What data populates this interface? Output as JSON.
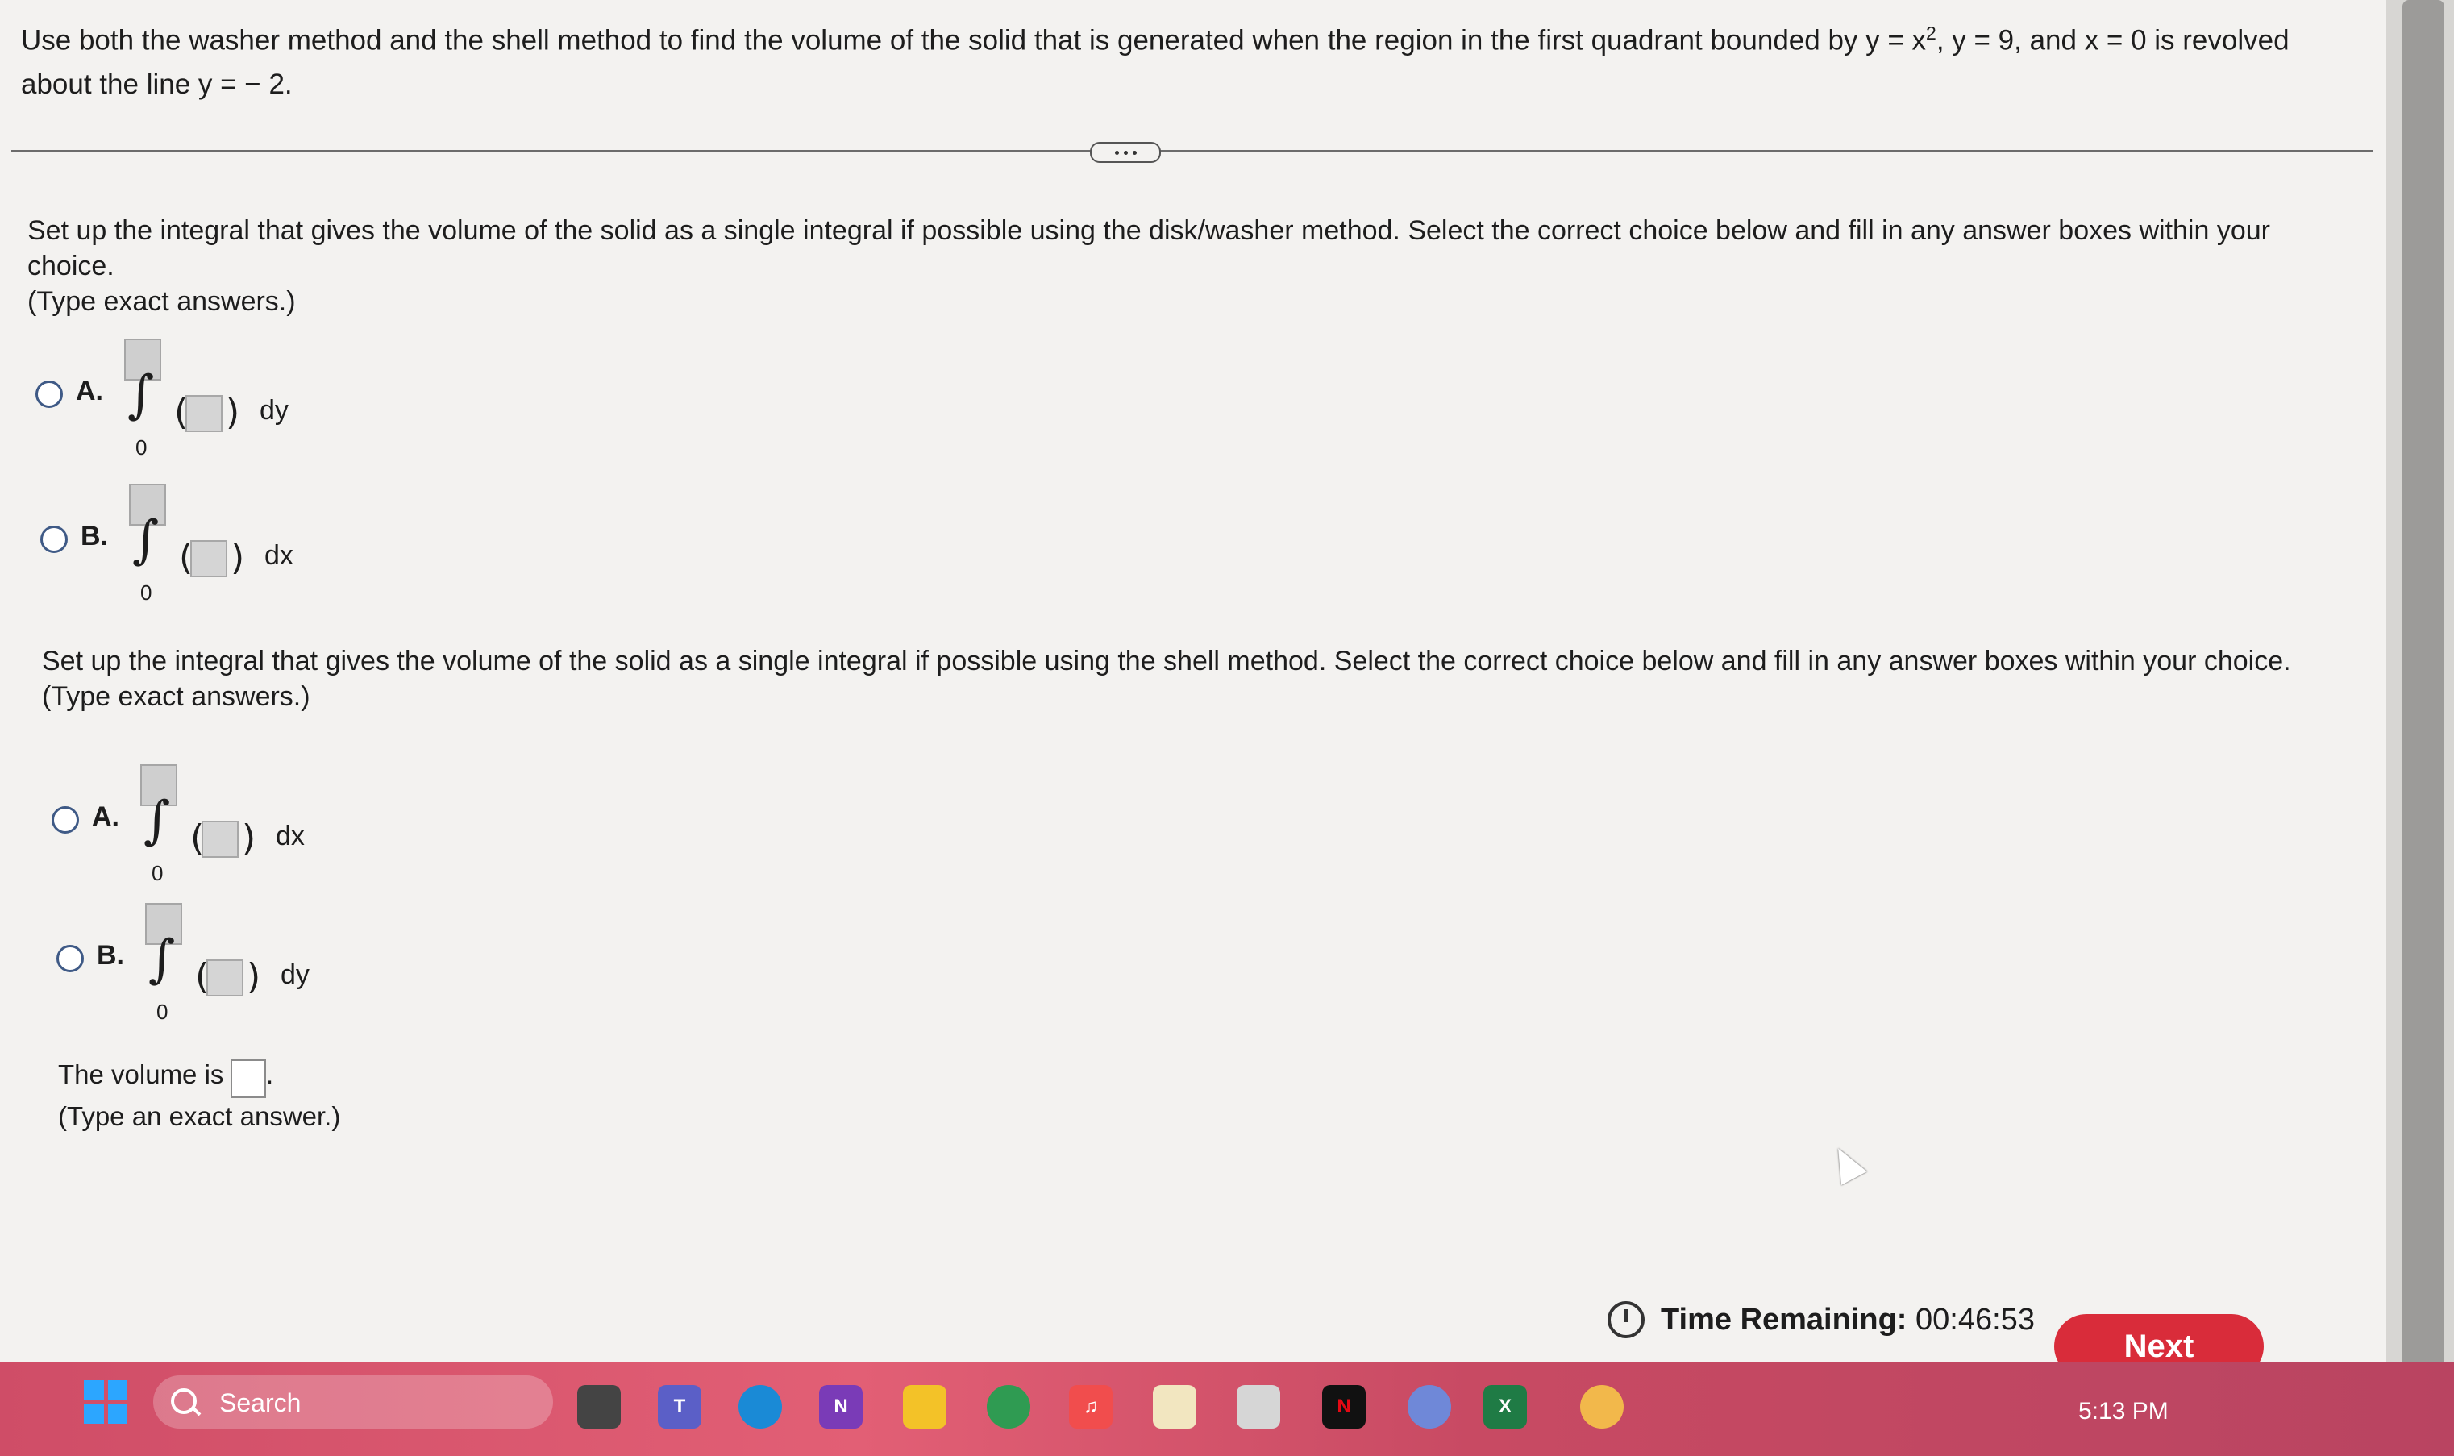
{
  "problem": {
    "text_part1": "Use both the washer method and the shell method to find the volume of the solid that is generated when the region in the first quadrant bounded by y = x",
    "exponent": "2",
    "text_part2": ", y = 9, and x = 0 is revolved about the line y = − 2."
  },
  "washer": {
    "instruction": "Set up the integral that gives the volume of the solid as a single integral if possible using the disk/washer method. Select the correct choice below and fill in any answer boxes within your choice.",
    "note": "(Type exact answers.)",
    "choices": [
      {
        "letter": "A.",
        "lower": "0",
        "variable": "dy"
      },
      {
        "letter": "B.",
        "lower": "0",
        "variable": "dx"
      }
    ]
  },
  "shell": {
    "instruction": "Set up the integral that gives the volume of the solid as a single integral if possible using the shell method. Select the correct choice below and fill in any answer boxes within your choice.",
    "note": "(Type exact answers.)",
    "choices": [
      {
        "letter": "A.",
        "lower": "0",
        "variable": "dx"
      },
      {
        "letter": "B.",
        "lower": "0",
        "variable": "dy"
      }
    ]
  },
  "volume": {
    "label": "The volume is",
    "punctuation": ".",
    "note": "(Type an exact answer.)"
  },
  "timer": {
    "label": "Time Remaining:",
    "value": "00:46:53"
  },
  "next_label": "Next",
  "taskbar": {
    "search_label": "Search",
    "clock": "5:13 PM",
    "icons": [
      "windows-icon",
      "search-icon",
      "files-icon",
      "teams-icon",
      "edge-icon",
      "onenote-icon",
      "file-explorer-icon",
      "chrome-icon",
      "music-icon",
      "snipping-tool-icon",
      "store-icon",
      "netflix-icon",
      "photos-icon",
      "excel-icon",
      "chrome-icon"
    ]
  },
  "colors": {
    "accent_red": "#d92c3a",
    "radio_blue": "#3f5a86",
    "taskbar_pink": "#cf4d67"
  }
}
